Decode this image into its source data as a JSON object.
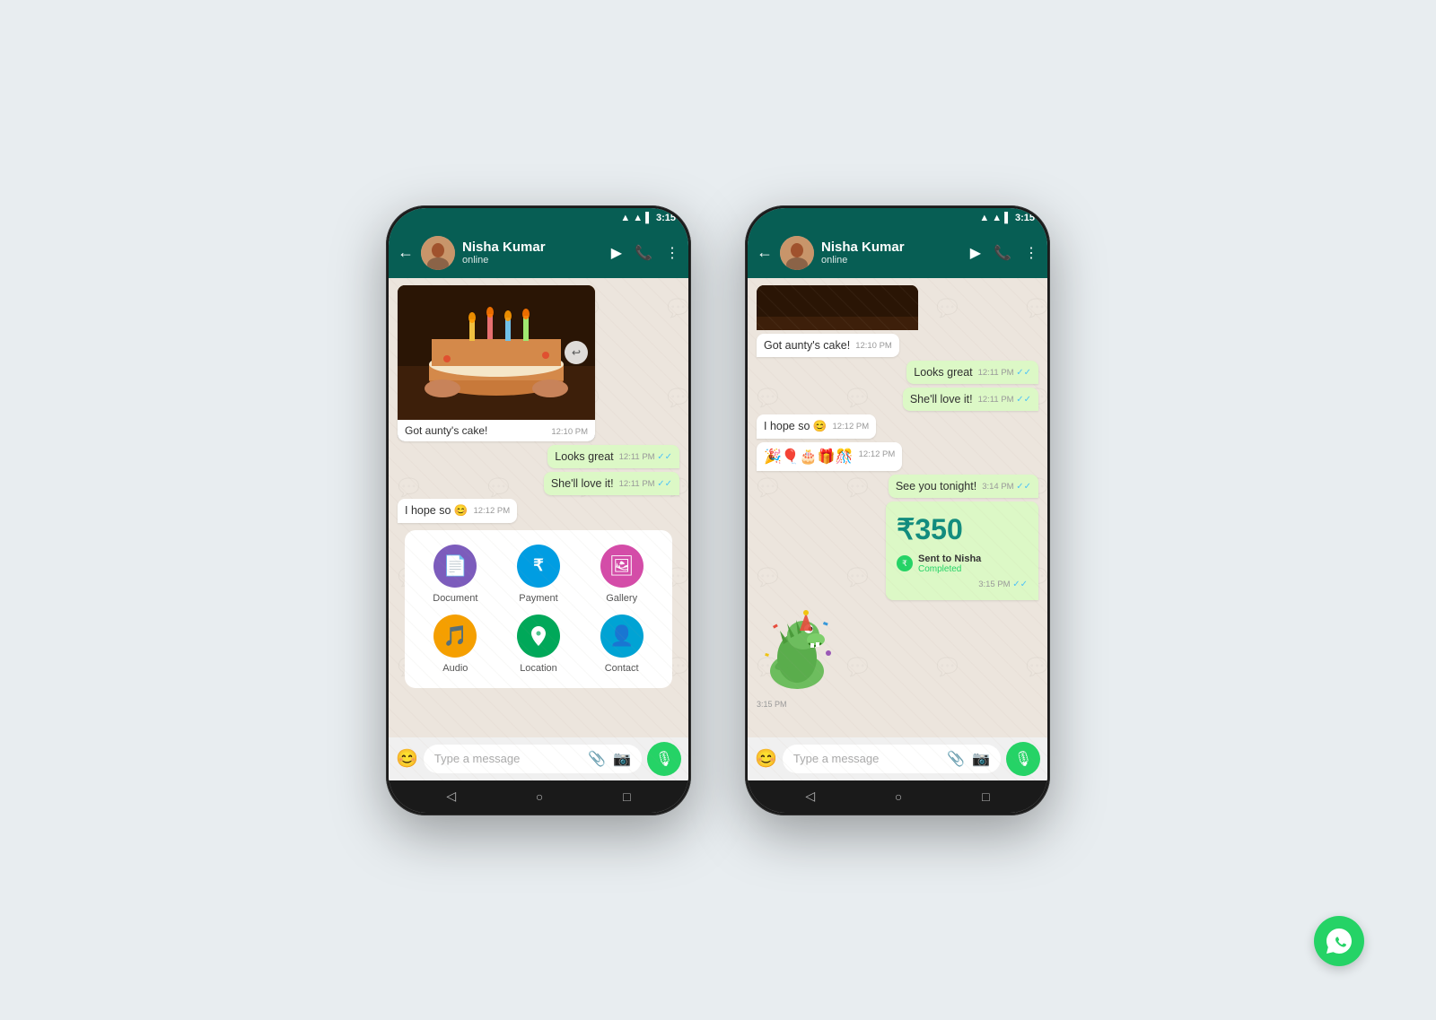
{
  "page": {
    "background": "#e8edf0"
  },
  "phone1": {
    "status_bar": {
      "time": "3:15",
      "signal": "▲",
      "wifi": "▲",
      "battery": "▌"
    },
    "header": {
      "contact_name": "Nisha Kumar",
      "contact_status": "online",
      "back_label": "←",
      "video_icon": "📹",
      "call_icon": "📞",
      "more_icon": "⋮"
    },
    "messages": [
      {
        "type": "received",
        "text": "Got aunty's cake!",
        "time": "12:10 PM"
      },
      {
        "type": "sent",
        "text": "Looks great",
        "time": "12:11 PM",
        "ticks": "✓✓"
      },
      {
        "type": "sent",
        "text": "She'll love it!",
        "time": "12:11 PM",
        "ticks": "✓✓"
      },
      {
        "type": "received",
        "text": "I hope so 😊",
        "time": "12:12 PM"
      }
    ],
    "attachment_menu": {
      "items": [
        {
          "id": "document",
          "label": "Document",
          "icon": "📄",
          "color": "#7c5cbc"
        },
        {
          "id": "payment",
          "label": "Payment",
          "icon": "₹",
          "color": "#009de2"
        },
        {
          "id": "gallery",
          "label": "Gallery",
          "icon": "🖼",
          "color": "#d44ca8"
        },
        {
          "id": "audio",
          "label": "Audio",
          "icon": "🎵",
          "color": "#f59f00"
        },
        {
          "id": "location",
          "label": "Location",
          "icon": "📍",
          "color": "#00a859"
        },
        {
          "id": "contact",
          "label": "Contact",
          "icon": "👤",
          "color": "#00a3d4"
        }
      ]
    },
    "input_bar": {
      "placeholder": "Type a message",
      "emoji_icon": "😊",
      "attach_icon": "📎",
      "camera_icon": "📷",
      "mic_icon": "🎙"
    },
    "nav_bar": {
      "back": "◁",
      "home": "○",
      "recent": "□"
    }
  },
  "phone2": {
    "status_bar": {
      "time": "3:15"
    },
    "header": {
      "contact_name": "Nisha Kumar",
      "contact_status": "online",
      "back_label": "←"
    },
    "messages": [
      {
        "type": "received",
        "text": "Got aunty's cake!",
        "time": "12:10 PM"
      },
      {
        "type": "sent",
        "text": "Looks great",
        "time": "12:11 PM",
        "ticks": "✓✓"
      },
      {
        "type": "sent",
        "text": "She'll love it!",
        "time": "12:11 PM",
        "ticks": "✓✓"
      },
      {
        "type": "received",
        "text": "I hope so 😊",
        "time": "12:12 PM"
      },
      {
        "type": "received_emoji",
        "text": "🎉🎈🎂🎁🎊",
        "time": "12:12 PM"
      },
      {
        "type": "sent",
        "text": "See you tonight!",
        "time": "3:14 PM",
        "ticks": "✓✓"
      }
    ],
    "payment": {
      "amount": "₹350",
      "sent_to": "Sent to Nisha",
      "status": "Completed",
      "time": "3:15 PM",
      "ticks": "✓✓"
    },
    "sticker_time": "3:15 PM",
    "input_bar": {
      "placeholder": "Type a message"
    },
    "nav_bar": {
      "back": "◁",
      "home": "○",
      "recent": "□"
    }
  },
  "whatsapp_logo": "💬"
}
